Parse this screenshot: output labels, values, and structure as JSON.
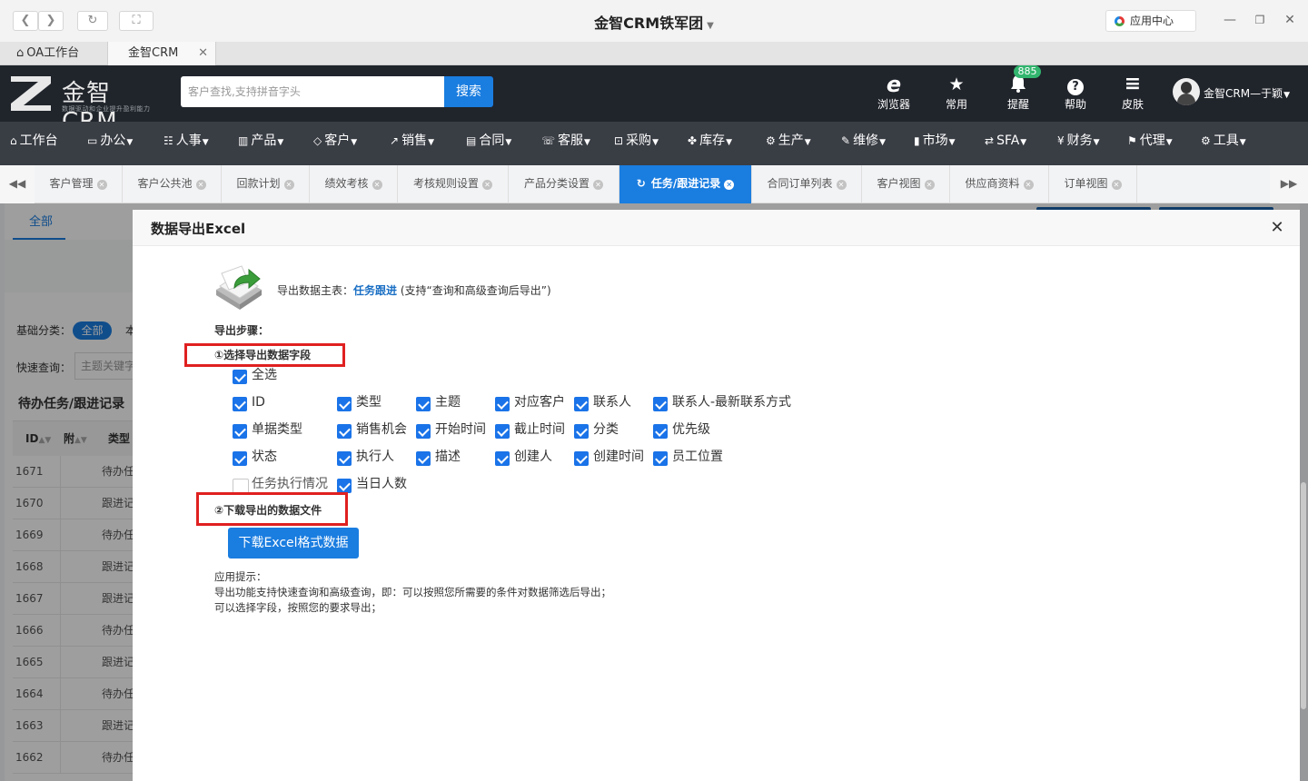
{
  "window": {
    "title": "金智CRM铁军团",
    "app_center": "应用中心"
  },
  "browser_tabs": [
    {
      "label": "OA工作台"
    },
    {
      "label": "金智CRM"
    }
  ],
  "header": {
    "logo_text": "金智CRM",
    "logo_sub": "数据驱动和企业提升盈利能力",
    "search_placeholder": "客户查找,支持拼音字头",
    "search_button": "搜索",
    "items": [
      {
        "label": "浏览器",
        "icon": "e"
      },
      {
        "label": "常用",
        "icon": "★"
      },
      {
        "label": "提醒",
        "icon": "🔔"
      },
      {
        "label": "帮助",
        "icon": "?"
      },
      {
        "label": "皮肤",
        "icon": "≡"
      }
    ],
    "notify_count": "885",
    "user": "金智CRM—于颖"
  },
  "main_nav": [
    {
      "label": "工作台",
      "glyph": "⌂",
      "caret": false
    },
    {
      "label": "办公",
      "glyph": "▭",
      "caret": true
    },
    {
      "label": "人事",
      "glyph": "☷",
      "caret": true
    },
    {
      "label": "产品",
      "glyph": "▥",
      "caret": true
    },
    {
      "label": "客户",
      "glyph": "◇",
      "caret": true
    },
    {
      "label": "销售",
      "glyph": "↗",
      "caret": true
    },
    {
      "label": "合同",
      "glyph": "▤",
      "caret": true
    },
    {
      "label": "客服",
      "glyph": "☏",
      "caret": true
    },
    {
      "label": "采购",
      "glyph": "⊡",
      "caret": true
    },
    {
      "label": "库存",
      "glyph": "✤",
      "caret": true
    },
    {
      "label": "生产",
      "glyph": "⚙",
      "caret": true
    },
    {
      "label": "维修",
      "glyph": "✎",
      "caret": true
    },
    {
      "label": "市场",
      "glyph": "▮",
      "caret": true
    },
    {
      "label": "SFA",
      "glyph": "⇄",
      "caret": true
    },
    {
      "label": "财务",
      "glyph": "¥",
      "caret": true
    },
    {
      "label": "代理",
      "glyph": "⚑",
      "caret": true
    },
    {
      "label": "工具",
      "glyph": "⚙",
      "caret": true
    }
  ],
  "page_tabs": [
    {
      "label": "客户管理",
      "active": false
    },
    {
      "label": "客户公共池",
      "active": false
    },
    {
      "label": "回款计划",
      "active": false
    },
    {
      "label": "绩效考核",
      "active": false
    },
    {
      "label": "考核规则设置",
      "active": false
    },
    {
      "label": "产品分类设置",
      "active": false
    },
    {
      "label": "任务/跟进记录",
      "active": true
    },
    {
      "label": "合同订单列表",
      "active": false
    },
    {
      "label": "客户视图",
      "active": false
    },
    {
      "label": "供应商资料",
      "active": false
    },
    {
      "label": "订单视图",
      "active": false
    }
  ],
  "background_page": {
    "tab_all": "全部",
    "category_label": "基础分类：",
    "category_pill": "全部",
    "category_next": "本",
    "quick_query_label": "快速查询：",
    "quick_query_placeholder": "主题关键字",
    "list_title": "待办任务/跟进记录",
    "columns": [
      "ID",
      "附",
      "类型"
    ],
    "rows": [
      {
        "id": "1671",
        "type": "待办任"
      },
      {
        "id": "1670",
        "type": "跟进记"
      },
      {
        "id": "1669",
        "type": "待办任"
      },
      {
        "id": "1668",
        "type": "跟进记"
      },
      {
        "id": "1667",
        "type": "跟进记"
      },
      {
        "id": "1666",
        "type": "待办任"
      },
      {
        "id": "1665",
        "type": "跟进记"
      },
      {
        "id": "1664",
        "type": "待办任"
      },
      {
        "id": "1663",
        "type": "跟进记"
      },
      {
        "id": "1662",
        "type": "待办任"
      }
    ]
  },
  "modal": {
    "title": "数据导出Excel",
    "main_table_prefix": "导出数据主表：",
    "main_table_name": "任务跟进",
    "main_table_suffix": " (支持“查询和高级查询后导出”)",
    "steps_label": "导出步骤：",
    "step1": "①选择导出数据字段",
    "step2": "②下载导出的数据文件",
    "select_all": "全选",
    "fields": [
      {
        "label": "ID",
        "checked": true
      },
      {
        "label": "类型",
        "checked": true
      },
      {
        "label": "主题",
        "checked": true
      },
      {
        "label": "对应客户",
        "checked": true
      },
      {
        "label": "联系人",
        "checked": true
      },
      {
        "label": "联系人-最新联系方式",
        "checked": true
      },
      {
        "label": "单据类型",
        "checked": true
      },
      {
        "label": "销售机会",
        "checked": true
      },
      {
        "label": "开始时间",
        "checked": true
      },
      {
        "label": "截止时间",
        "checked": true
      },
      {
        "label": "分类",
        "checked": true
      },
      {
        "label": "优先级",
        "checked": true
      },
      {
        "label": "状态",
        "checked": true
      },
      {
        "label": "执行人",
        "checked": true
      },
      {
        "label": "描述",
        "checked": true
      },
      {
        "label": "创建人",
        "checked": true
      },
      {
        "label": "创建时间",
        "checked": true
      },
      {
        "label": "员工位置",
        "checked": true
      },
      {
        "label": "任务执行情况",
        "checked": false
      },
      {
        "label": "当日人数",
        "checked": true
      }
    ],
    "download_button": "下载Excel格式数据",
    "tips": [
      "应用提示：",
      "导出功能支持快速查询和高级查询，即：可以按照您所需要的条件对数据筛选后导出；",
      "可以选择字段，按照您的要求导出；"
    ]
  },
  "colors": {
    "accent": "#1a7de0",
    "header_bg": "#20242b",
    "nav_bg": "#393d44",
    "badge": "#32b56e",
    "highlight_box": "#e02020"
  }
}
